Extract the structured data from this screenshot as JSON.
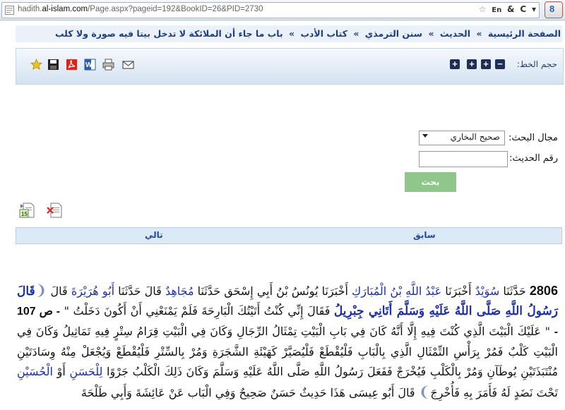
{
  "browser": {
    "url_prefix": "hadith.",
    "url_domain": "al-islam.com",
    "url_suffix": "/Page.aspx?pageid=192&BookID=26&PID=2730",
    "reader_label": "&",
    "google_label": "8"
  },
  "breadcrumb": [
    "الصفحة الرئيسية",
    "الحديث",
    "سنن الترمذي",
    "كتاب الأدب",
    "باب ما جاء أن الملائكة لا تدخل بيتا فيه صورة ولا كلب"
  ],
  "breadcrumb_sep": "»",
  "toolbar": {
    "font_size_label": "حجم الخط:",
    "minus": "−",
    "plus": "+"
  },
  "search": {
    "field_label": "مجال البحث:",
    "field_value": "صحيح البخاري",
    "number_label": "رقم الحديث:",
    "number_value": "",
    "button_label": "بحث"
  },
  "nav": {
    "prev_label": "سابق",
    "next_label": "تالي"
  },
  "hadith": {
    "number": "2806",
    "t1": "حَدَّثَنَا",
    "n1": "سُوَيْدٌ",
    "t2": "أَخْبَرَنَا",
    "n2": "عَبْدُ اللَّهِ بْنُ الْمُبَارَكِ",
    "t3": "أَخْبَرَنَا يُونُسُ بْنُ أَبِي إِسْحَق حَدَّثَنَا",
    "n3": "مُجَاهِدٌ",
    "t4": "قَالَ حَدَّثَنَا",
    "n4": "أَبُو هُرَيْرَةَ",
    "t5": "قَالَ",
    "q1": "قَالَ رَسُولُ اللَّهِ صَلَّى اللَّهُ عَلَيْهِ وَسَلَّمَ أَتَانِي جِبْرِيلُ",
    "t6": "فَقَالَ إِنِّي كُنْتُ أَتَيْتُكَ الْبَارِحَةَ فَلَمْ يَمْنَعْنِي أَنْ أَكُونَ دَخَلْتُ \"",
    "page_marker": "- ص 107 -",
    "t7": "\" عَلَيْكَ الْبَيْتَ الَّذِي كُنْتَ فِيهِ إِلَّا أَنَّهُ كَانَ فِي بَابِ الْبَيْتِ تِمْثَالُ الرِّجَالِ وَكَانَ فِي الْبَيْتِ قِرَامُ سِتْرٍ فِيهِ تَمَاثِيلُ وَكَانَ فِي الْبَيْتِ كَلْبٌ فَمُرْ بِرَأْسِ التِّمْثَالِ الَّذِي بِالْبَابِ فَلْيُقْطَعْ فَلْيُصَيَّرْ كَهَيْئَةِ الشَّجَرَةِ وَمُرْ بِالسِّتْرِ فَلْيُقْطَعْ وَيُجْعَلْ مِنْهُ وِسَادَتَيْنِ مُنْتَبَذَتَيْنِ يُوطَآنِ وَمُرْ بِالْكَلْبِ فَيُخْرَجْ فَفَعَلَ رَسُولُ اللَّهِ صَلَّى اللَّهُ عَلَيْهِ وَسَلَّمَ وَكَانَ ذَلِكَ الْكَلْبُ جَرْوًا",
    "n5": "لِلْحَسَنِ",
    "t8": "أَوْ",
    "n6": "الْحُسَيْنِ",
    "t9": "تَحْتَ نَضَدٍ لَهُ فَأَمَرَ بِهِ فَأُخْرِجَ",
    "t10": "قَالَ أَبُو عِيسَى هَذَا حَدِيثٌ حَسَنٌ صَحِيحٌ وَفِي الْبَاب عَنْ عَائِشَةَ وَأَبِي طَلْحَةَ"
  }
}
